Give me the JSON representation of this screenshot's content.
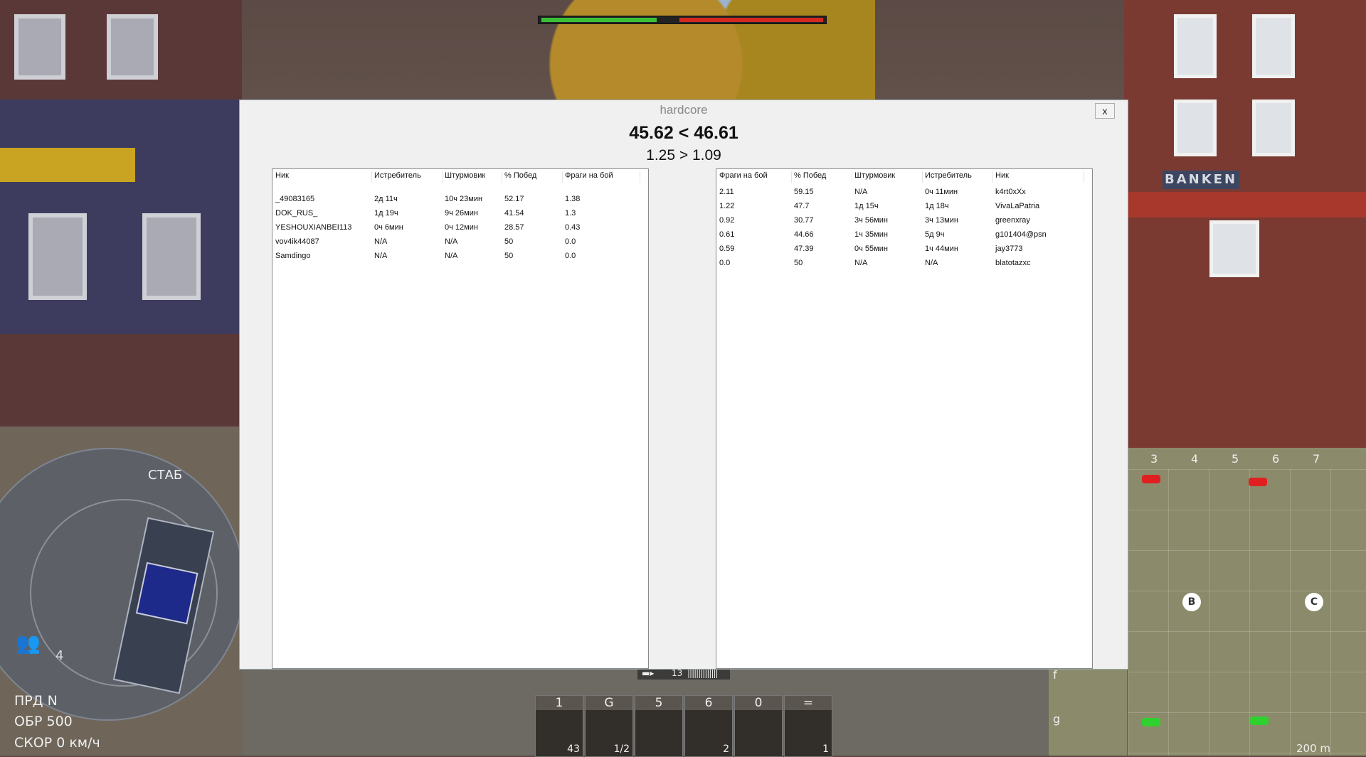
{
  "dialog": {
    "title": "hardcore",
    "close_label": "x",
    "score_line": "45.62 < 46.61",
    "ratio_line": "1.25 > 1.09"
  },
  "left_team": {
    "columns": [
      "Ник",
      "Истребитель",
      "Штурмовик",
      "% Побед",
      "Фраги на бой"
    ],
    "rows": [
      [
        "_49083165",
        "2д 11ч",
        "10ч 23мин",
        "52.17",
        "1.38"
      ],
      [
        "DOK_RUS_",
        "1д 19ч",
        "9ч 26мин",
        "41.54",
        "1.3"
      ],
      [
        "YESHOUXIANBEI113",
        "0ч 6мин",
        "0ч 12мин",
        "28.57",
        "0.43"
      ],
      [
        "vov4ik44087",
        "N/A",
        "N/A",
        "50",
        "0.0"
      ],
      [
        "Samdingo",
        "N/A",
        "N/A",
        "50",
        "0.0"
      ]
    ]
  },
  "right_team": {
    "columns": [
      "Фраги на бой",
      "% Побед",
      "Штурмовик",
      "Истребитель",
      "Ник"
    ],
    "rows": [
      [
        "2.11",
        "59.15",
        "N/A",
        "0ч 11мин",
        "k4rt0xXx"
      ],
      [
        "1.22",
        "47.7",
        "1д 15ч",
        "1д 18ч",
        "VivaLaPatria"
      ],
      [
        "0.92",
        "30.77",
        "3ч 56мин",
        "3ч 13мин",
        "greenxray"
      ],
      [
        "0.61",
        "44.66",
        "1ч 35мин",
        "5д 9ч",
        "g101404@psn"
      ],
      [
        "0.59",
        "47.39",
        "0ч 55мин",
        "1ч 44мин",
        "jay3773"
      ],
      [
        "0.0",
        "50",
        "N/A",
        "N/A",
        "blatotazxc"
      ]
    ]
  },
  "hud": {
    "stab_label": "СТАБ",
    "crew_count": "4",
    "gear": "ПРД N",
    "rpm": "ОБР 500",
    "speed": "СКОР 0 км/ч",
    "ammo_count": "13",
    "slots": [
      {
        "key": "1",
        "count": "43"
      },
      {
        "key": "G",
        "count": "1/2"
      },
      {
        "key": "5",
        "count": ""
      },
      {
        "key": "6",
        "count": "2"
      },
      {
        "key": "0",
        "count": ""
      },
      {
        "key": "=",
        "count": "1"
      }
    ],
    "map_columns": [
      "3",
      "4",
      "5",
      "6",
      "7"
    ],
    "map_rows": [
      "f",
      "g"
    ],
    "capture_points": [
      "B",
      "C"
    ],
    "map_scale": "200 m",
    "sign": "BANKEN",
    "team_health": {
      "friendly": 0.41,
      "enemy": 0.51
    },
    "colors": {
      "friendly": "#3bbf37",
      "enemy": "#d22a22"
    }
  }
}
